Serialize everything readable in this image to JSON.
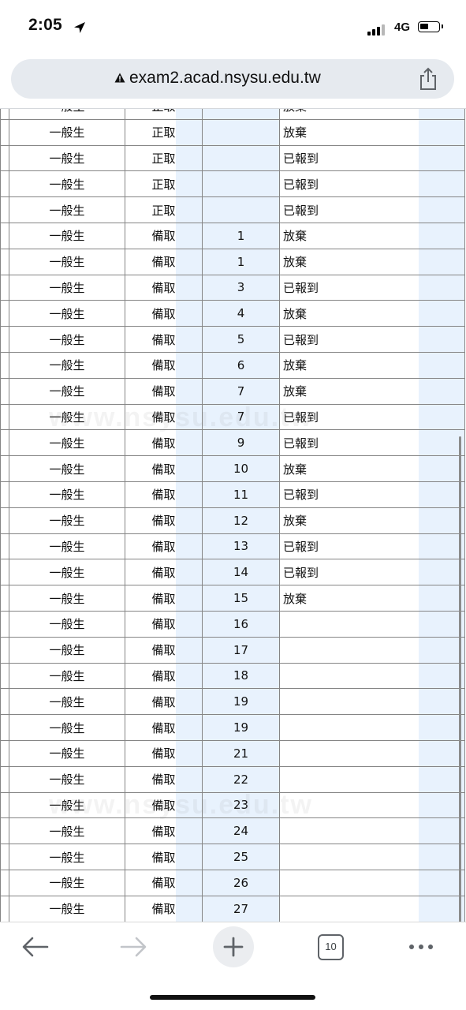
{
  "status_bar": {
    "time": "2:05",
    "network": "4G",
    "icons": [
      "location-arrow-icon",
      "signal-bars-icon",
      "battery-icon"
    ]
  },
  "browser": {
    "url": "exam2.acad.nsysu.edu.tw",
    "icons": [
      "warning-icon",
      "share-icon"
    ]
  },
  "table": {
    "rows": [
      {
        "type": "一般生",
        "admission": "正取",
        "rank": "",
        "status": "放棄"
      },
      {
        "type": "一般生",
        "admission": "正取",
        "rank": "",
        "status": "放棄"
      },
      {
        "type": "一般生",
        "admission": "正取",
        "rank": "",
        "status": "已報到"
      },
      {
        "type": "一般生",
        "admission": "正取",
        "rank": "",
        "status": "已報到"
      },
      {
        "type": "一般生",
        "admission": "正取",
        "rank": "",
        "status": "已報到"
      },
      {
        "type": "一般生",
        "admission": "備取",
        "rank": "1",
        "status": "放棄"
      },
      {
        "type": "一般生",
        "admission": "備取",
        "rank": "1",
        "status": "放棄"
      },
      {
        "type": "一般生",
        "admission": "備取",
        "rank": "3",
        "status": "已報到"
      },
      {
        "type": "一般生",
        "admission": "備取",
        "rank": "4",
        "status": "放棄"
      },
      {
        "type": "一般生",
        "admission": "備取",
        "rank": "5",
        "status": "已報到"
      },
      {
        "type": "一般生",
        "admission": "備取",
        "rank": "6",
        "status": "放棄"
      },
      {
        "type": "一般生",
        "admission": "備取",
        "rank": "7",
        "status": "放棄"
      },
      {
        "type": "一般生",
        "admission": "備取",
        "rank": "7",
        "status": "已報到"
      },
      {
        "type": "一般生",
        "admission": "備取",
        "rank": "9",
        "status": "已報到"
      },
      {
        "type": "一般生",
        "admission": "備取",
        "rank": "10",
        "status": "放棄"
      },
      {
        "type": "一般生",
        "admission": "備取",
        "rank": "11",
        "status": "已報到"
      },
      {
        "type": "一般生",
        "admission": "備取",
        "rank": "12",
        "status": "放棄"
      },
      {
        "type": "一般生",
        "admission": "備取",
        "rank": "13",
        "status": "已報到"
      },
      {
        "type": "一般生",
        "admission": "備取",
        "rank": "14",
        "status": "已報到"
      },
      {
        "type": "一般生",
        "admission": "備取",
        "rank": "15",
        "status": "放棄"
      },
      {
        "type": "一般生",
        "admission": "備取",
        "rank": "16",
        "status": ""
      },
      {
        "type": "一般生",
        "admission": "備取",
        "rank": "17",
        "status": ""
      },
      {
        "type": "一般生",
        "admission": "備取",
        "rank": "18",
        "status": ""
      },
      {
        "type": "一般生",
        "admission": "備取",
        "rank": "19",
        "status": ""
      },
      {
        "type": "一般生",
        "admission": "備取",
        "rank": "19",
        "status": ""
      },
      {
        "type": "一般生",
        "admission": "備取",
        "rank": "21",
        "status": ""
      },
      {
        "type": "一般生",
        "admission": "備取",
        "rank": "22",
        "status": ""
      },
      {
        "type": "一般生",
        "admission": "備取",
        "rank": "23",
        "status": ""
      },
      {
        "type": "一般生",
        "admission": "備取",
        "rank": "24",
        "status": ""
      },
      {
        "type": "一般生",
        "admission": "備取",
        "rank": "25",
        "status": ""
      },
      {
        "type": "一般生",
        "admission": "備取",
        "rank": "26",
        "status": ""
      },
      {
        "type": "一般生",
        "admission": "備取",
        "rank": "27",
        "status": ""
      }
    ],
    "column_highlight_color": "#e8f2fd",
    "watermark": "www.nsysu.edu.tw"
  },
  "toolbar": {
    "tab_count": "10",
    "icons": [
      "back-arrow-icon",
      "forward-arrow-icon",
      "plus-icon",
      "tabs-icon",
      "more-dots-icon"
    ]
  }
}
